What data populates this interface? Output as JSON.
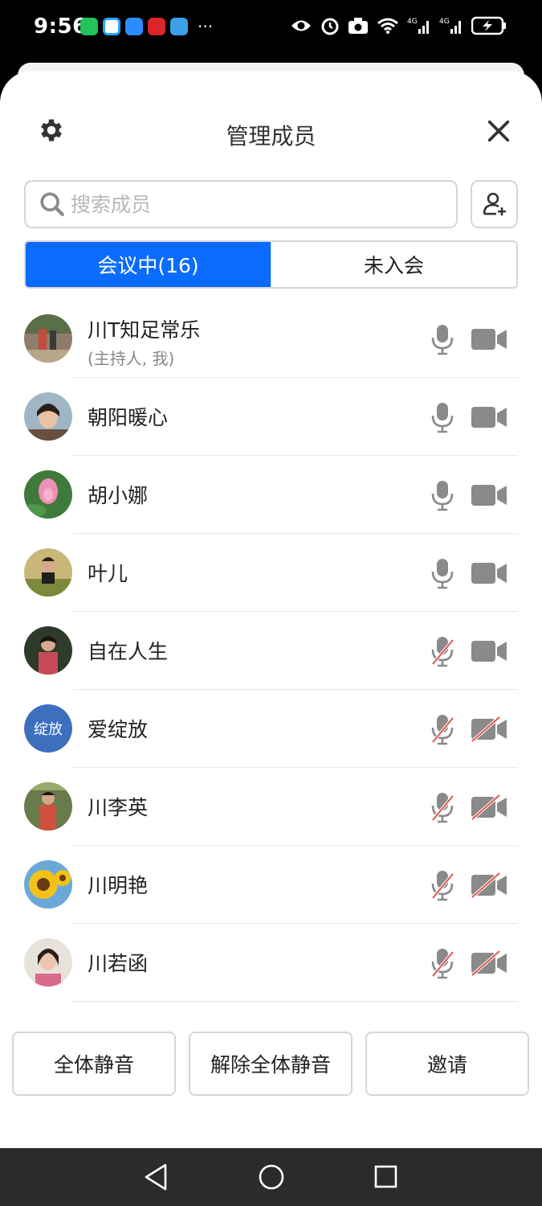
{
  "status_bar": {
    "time": "9:56",
    "apps": [
      "wechat-icon",
      "chat-bubble-icon",
      "message-icon",
      "red-app-icon",
      "blue-app-icon"
    ],
    "more": "···",
    "right_icons": [
      "eye-icon",
      "alarm-icon",
      "camera-icon",
      "wifi-icon",
      "signal-4g-icon",
      "signal-4g-icon",
      "battery-charging-icon"
    ]
  },
  "header": {
    "title": "管理成员",
    "settings_icon": "gear-icon",
    "close_icon": "close-icon"
  },
  "search": {
    "placeholder": "搜索成员",
    "value": ""
  },
  "add_member_icon": "add-person-icon",
  "tabs": [
    {
      "label": "会议中(16)",
      "active": true
    },
    {
      "label": "未入会",
      "active": false
    }
  ],
  "members": [
    {
      "name": "川T知足常乐",
      "sub": "(主持人, 我)",
      "mic": "on",
      "camera": "on"
    },
    {
      "name": "朝阳暖心",
      "sub": "",
      "mic": "on",
      "camera": "on"
    },
    {
      "name": "胡小娜",
      "sub": "",
      "mic": "on",
      "camera": "on"
    },
    {
      "name": "叶儿",
      "sub": "",
      "mic": "on",
      "camera": "on"
    },
    {
      "name": "自在人生",
      "sub": "",
      "mic": "muted",
      "camera": "on"
    },
    {
      "name": "爱绽放",
      "sub": "",
      "avatar_text": "绽放",
      "mic": "muted",
      "camera": "off"
    },
    {
      "name": "川李英",
      "sub": "",
      "mic": "muted",
      "camera": "off"
    },
    {
      "name": "川明艳",
      "sub": "",
      "mic": "muted",
      "camera": "off"
    },
    {
      "name": "川若函",
      "sub": "",
      "mic": "muted",
      "camera": "off"
    }
  ],
  "footer": {
    "mute_all": "全体静音",
    "unmute_all": "解除全体静音",
    "invite": "邀请"
  },
  "colors": {
    "accent": "#0a6cff",
    "icon_gray": "#8a8a8a",
    "muted_red": "#e0564a",
    "avatar_text_bg": "#3d6fbf"
  }
}
